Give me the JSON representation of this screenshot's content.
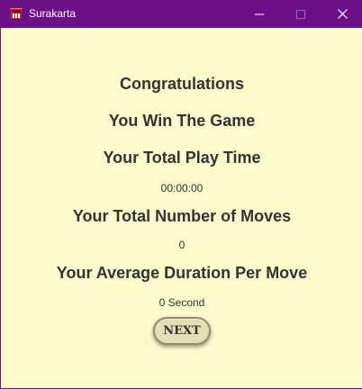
{
  "window": {
    "title": "Surakarta",
    "icon": "surakarta-app-icon",
    "controls": {
      "minimize_icon": "minimize-icon",
      "maximize_icon": "maximize-icon",
      "close_icon": "close-icon"
    },
    "colors": {
      "titlebar": "#6c1087",
      "background": "#fffacb",
      "text": "#333333",
      "button_fill": "#e3dfb3"
    }
  },
  "result": {
    "congratulations": "Congratulations",
    "win_message": "You Win The Game",
    "play_time_label": "Your Total Play Time",
    "play_time_value": "00:00:00",
    "moves_label": "Your Total Number of Moves",
    "moves_value": "0",
    "avg_duration_label": "Your Average Duration Per Move",
    "avg_duration_value": "0 Second",
    "next_label": "NEXT"
  }
}
